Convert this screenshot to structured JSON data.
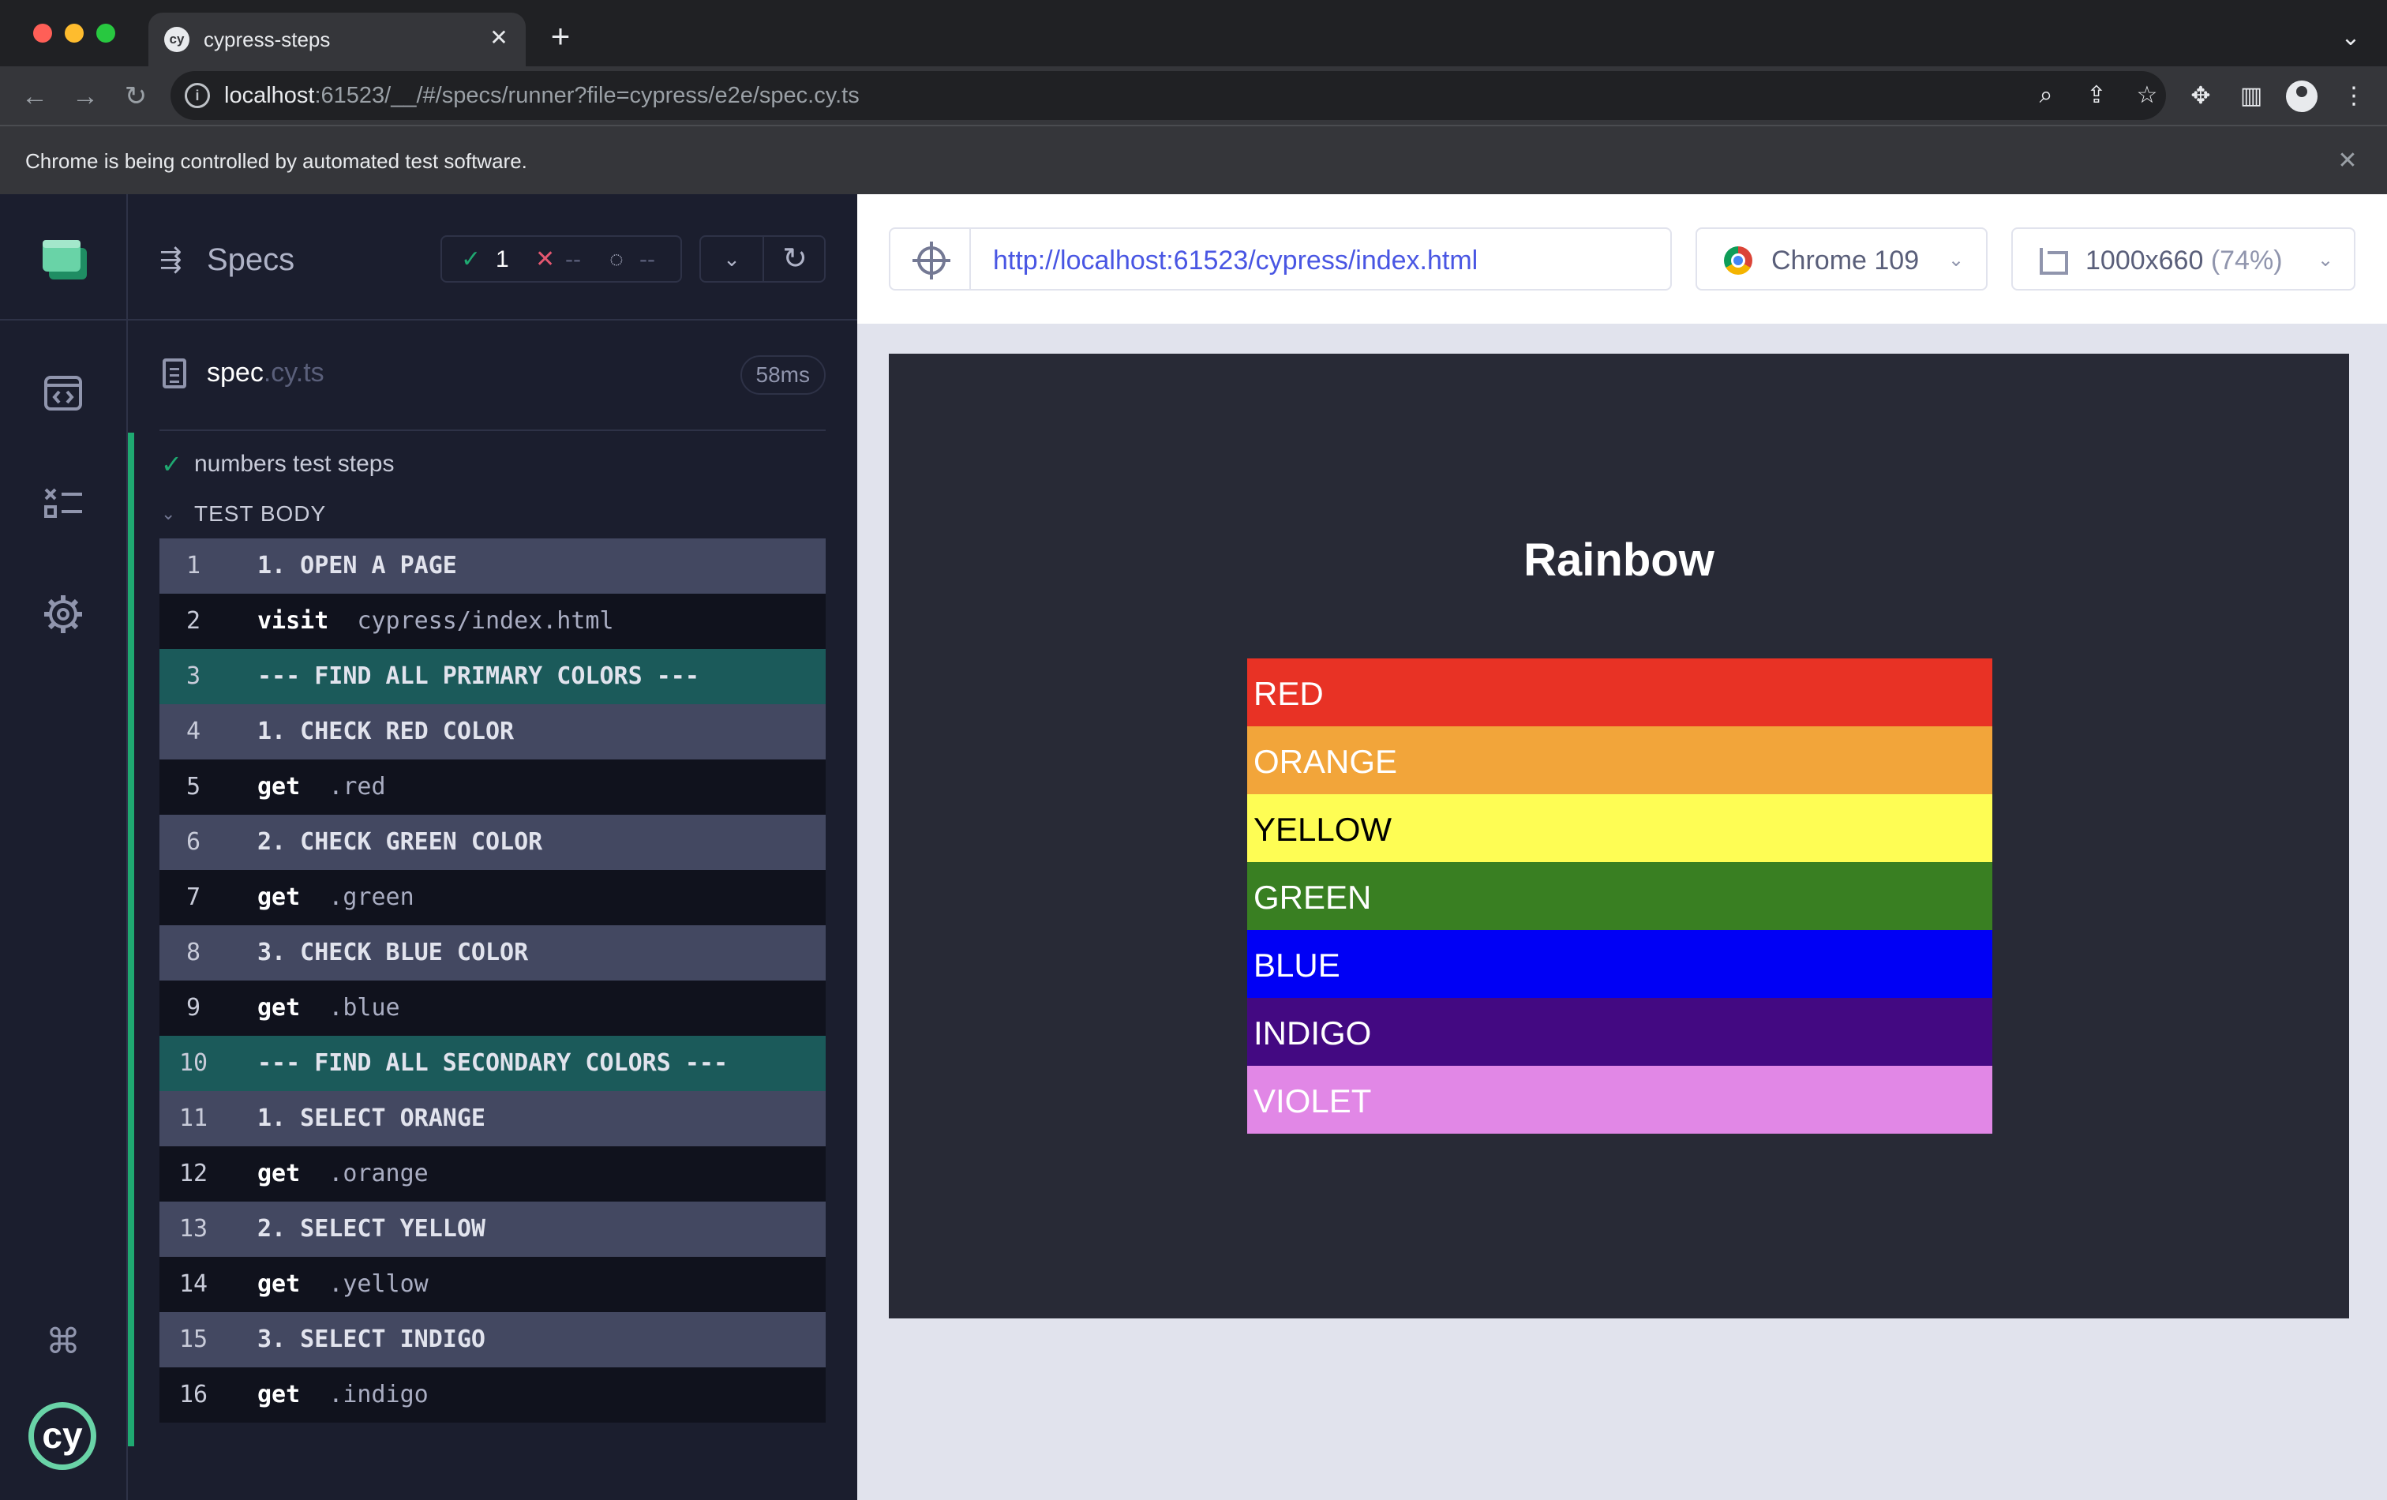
{
  "browser": {
    "tab_title": "cypress-steps",
    "tab_favicon": "cy",
    "url_host": "localhost",
    "url_path": ":61523/__/#/specs/runner?file=cypress/e2e/spec.cy.ts",
    "infobar_text": "Chrome is being controlled by automated test software."
  },
  "icons": {
    "traffic_close": "#ff5f57",
    "traffic_minimize": "#febc2e",
    "traffic_zoom": "#28c840"
  },
  "reporter": {
    "header_title": "Specs",
    "stats": {
      "passed": "1",
      "failed": "--",
      "pending": "--"
    },
    "file": {
      "name": "spec",
      "ext": ".cy.ts",
      "duration": "58ms"
    },
    "test_title": "numbers test steps",
    "test_body_label": "TEST BODY",
    "commands": [
      {
        "num": "1",
        "kind": "step",
        "text": "1. OPEN A PAGE"
      },
      {
        "num": "2",
        "kind": "action",
        "name": "visit",
        "arg": "cypress/index.html"
      },
      {
        "num": "3",
        "kind": "group",
        "text": "--- FIND ALL PRIMARY COLORS ---"
      },
      {
        "num": "4",
        "kind": "step",
        "text": "1. CHECK RED COLOR"
      },
      {
        "num": "5",
        "kind": "action",
        "name": "get",
        "arg": ".red"
      },
      {
        "num": "6",
        "kind": "step",
        "text": "2. CHECK GREEN COLOR"
      },
      {
        "num": "7",
        "kind": "action",
        "name": "get",
        "arg": ".green"
      },
      {
        "num": "8",
        "kind": "step",
        "text": "3. CHECK BLUE COLOR"
      },
      {
        "num": "9",
        "kind": "action",
        "name": "get",
        "arg": ".blue"
      },
      {
        "num": "10",
        "kind": "group",
        "text": "--- FIND ALL SECONDARY COLORS ---"
      },
      {
        "num": "11",
        "kind": "step",
        "text": "1. SELECT ORANGE"
      },
      {
        "num": "12",
        "kind": "action",
        "name": "get",
        "arg": ".orange"
      },
      {
        "num": "13",
        "kind": "step",
        "text": "2. SELECT YELLOW"
      },
      {
        "num": "14",
        "kind": "action",
        "name": "get",
        "arg": ".yellow"
      },
      {
        "num": "15",
        "kind": "step",
        "text": "3. SELECT INDIGO"
      },
      {
        "num": "16",
        "kind": "action",
        "name": "get",
        "arg": ".indigo"
      }
    ]
  },
  "aut": {
    "url": "http://localhost:61523/cypress/index.html",
    "browser_label": "Chrome 109",
    "viewport_label": "1000x660",
    "viewport_scale": "(74%)",
    "page_title": "Rainbow",
    "bands": [
      {
        "label": "RED",
        "color": "#e83225",
        "text_color": "#ffffff"
      },
      {
        "label": "ORANGE",
        "color": "#f2a53a",
        "text_color": "#ffffff"
      },
      {
        "label": "YELLOW",
        "color": "#fefd54",
        "text_color": "#000000"
      },
      {
        "label": "GREEN",
        "color": "#397f22",
        "text_color": "#ffffff"
      },
      {
        "label": "BLUE",
        "color": "#0000f5",
        "text_color": "#ffffff"
      },
      {
        "label": "INDIGO",
        "color": "#430982",
        "text_color": "#ffffff"
      },
      {
        "label": "VIOLET",
        "color": "#e187e6",
        "text_color": "#ffffff"
      }
    ]
  }
}
